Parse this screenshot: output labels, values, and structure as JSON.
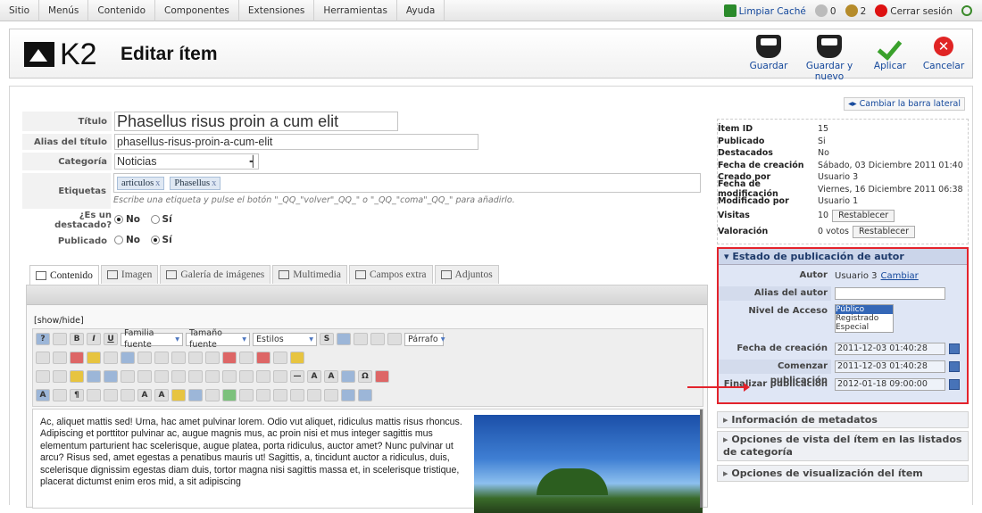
{
  "topbar": {
    "menu": [
      "Sitio",
      "Menús",
      "Contenido",
      "Componentes",
      "Extensiones",
      "Herramientas",
      "Ayuda"
    ],
    "clear_cache": "Limpiar Caché",
    "visitors": "0",
    "admins": "2",
    "logout": "Cerrar sesión"
  },
  "header": {
    "logo_text": "K2",
    "title": "Editar ítem",
    "save": "Guardar",
    "save_new": "Guardar y nuevo",
    "apply": "Aplicar",
    "cancel": "Cancelar"
  },
  "form": {
    "title_label": "Título",
    "title_value": "Phasellus risus proin a cum elit",
    "alias_label": "Alias del título",
    "alias_value": "phasellus-risus-proin-a-cum-elit",
    "category_label": "Categoría",
    "category_value": "Noticias",
    "tags_label": "Etiquetas",
    "tags": [
      "articulos",
      "Phasellus"
    ],
    "tag_remove": "x",
    "tags_hint": "Escribe una etiqueta y pulse el botón \"_QQ_\"volver\"_QQ_\" o \"_QQ_\"coma\"_QQ_\" para añadirlo.",
    "featured_label": "¿Es un destacado?",
    "published_label": "Publicado",
    "no": "No",
    "yes": "Sí"
  },
  "tabs": [
    "Contenido",
    "Imagen",
    "Galería de imágenes",
    "Multimedia",
    "Campos extra",
    "Adjuntos"
  ],
  "editor": {
    "showhide": "[show/hide]",
    "font_family": "Familia fuente",
    "font_size": "Tamaño fuente",
    "styles": "Estilos",
    "format": "Párrafo",
    "content": "Ac, aliquet mattis sed! Urna, hac amet pulvinar lorem. Odio vut aliquet, ridiculus mattis risus rhoncus. Adipiscing et porttitor pulvinar ac, augue magnis mus, ac proin nisi et mus integer sagittis mus elementum parturient hac scelerisque, augue platea, porta ridiculus, auctor amet? Nunc pulvinar ut arcu? Risus sed, amet egestas a penatibus mauris ut! Sagittis, a, tincidunt auctor a ridiculus, duis, scelerisque dignissim egestas diam duis, tortor magna nisi sagittis massa et, in scelerisque tristique, placerat dictumst enim eros mid, a sit adipiscing"
  },
  "sidebar": {
    "toggle": "Cambiar la barra lateral",
    "info": [
      {
        "k": "Ítem ID",
        "v": "15"
      },
      {
        "k": "Publicado",
        "v": "Si"
      },
      {
        "k": "Destacados",
        "v": "No"
      },
      {
        "k": "Fecha de creación",
        "v": "Sábado, 03 Diciembre 2011 01:40"
      },
      {
        "k": "Creado por",
        "v": "Usuario 3"
      },
      {
        "k": "Fecha de modificación",
        "v": "Viernes, 16 Diciembre 2011 06:38"
      },
      {
        "k": "Modificado por",
        "v": "Usuario 1"
      },
      {
        "k": "Visitas",
        "v": "10"
      },
      {
        "k": "Valoración",
        "v": "0 votos"
      }
    ],
    "reset": "Restablecer",
    "pub_title": "Estado de publicación de autor",
    "author_label": "Autor",
    "author_value": "Usuario 3",
    "change": "Cambiar",
    "alias_author_label": "Alias del autor",
    "access_label": "Nivel de Acceso",
    "access_options": [
      "Público",
      "Registrado",
      "Especial"
    ],
    "created_label": "Fecha de creación",
    "created_value": "2011-12-03 01:40:28",
    "start_label": "Comenzar publicación",
    "start_value": "2011-12-03 01:40:28",
    "end_label": "Finalizar publicación",
    "end_value": "2012-01-18 09:00:00",
    "acc_metadata": "Información de metadatos",
    "acc_listing": "Opciones de vista del ítem en las listados de categoría",
    "acc_display": "Opciones de visualización del ítem"
  }
}
